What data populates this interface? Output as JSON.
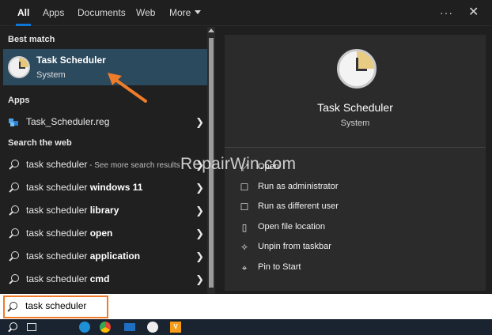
{
  "tabs": [
    {
      "label": "All",
      "active": true
    },
    {
      "label": "Apps"
    },
    {
      "label": "Documents"
    },
    {
      "label": "Web"
    },
    {
      "label": "More"
    }
  ],
  "header": {
    "options_icon": "ellipsis-icon",
    "close_icon": "close-icon"
  },
  "left": {
    "best_match_label": "Best match",
    "best_match": {
      "title": "Task Scheduler",
      "subtitle": "System",
      "icon": "task-scheduler-icon"
    },
    "apps_label": "Apps",
    "apps": [
      {
        "label": "Task_Scheduler.reg",
        "icon": "registry-file-icon"
      }
    ],
    "web_label": "Search the web",
    "web_results": [
      {
        "prefix": "task scheduler",
        "bold": "",
        "suffix": " - See more search results"
      },
      {
        "prefix": "task scheduler ",
        "bold": "windows 11",
        "suffix": ""
      },
      {
        "prefix": "task scheduler ",
        "bold": "library",
        "suffix": ""
      },
      {
        "prefix": "task scheduler ",
        "bold": "open",
        "suffix": ""
      },
      {
        "prefix": "task scheduler ",
        "bold": "application",
        "suffix": ""
      },
      {
        "prefix": "task scheduler ",
        "bold": "cmd",
        "suffix": ""
      }
    ]
  },
  "right": {
    "title": "Task Scheduler",
    "subtitle": "System",
    "actions": [
      {
        "label": "Open",
        "icon": "open-icon"
      },
      {
        "label": "Run as administrator",
        "icon": "shield-icon"
      },
      {
        "label": "Run as different user",
        "icon": "user-icon"
      },
      {
        "label": "Open file location",
        "icon": "file-location-icon"
      },
      {
        "label": "Unpin from taskbar",
        "icon": "unpin-icon"
      },
      {
        "label": "Pin to Start",
        "icon": "pin-icon"
      }
    ]
  },
  "watermark": "RepairWin.com",
  "search": {
    "value": "task scheduler"
  },
  "colors": {
    "accent": "#0a78d4",
    "highlight": "#f07c2a",
    "selected_bg": "#2c4a5e"
  }
}
